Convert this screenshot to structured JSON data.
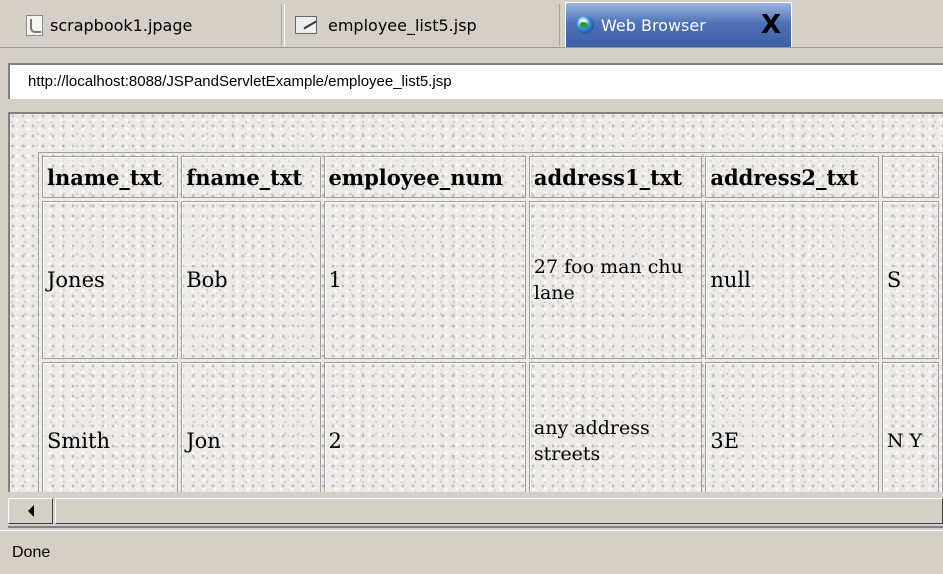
{
  "tabs": [
    {
      "label": "scrapbook1.jpage",
      "icon": "jpage-file-icon",
      "active": false
    },
    {
      "label": "employee_list5.jsp",
      "icon": "jsp-file-icon",
      "active": false
    },
    {
      "label": "Web Browser",
      "icon": "globe-icon",
      "active": true,
      "close_label": "X"
    }
  ],
  "address": {
    "url": "http://localhost:8088/JSPandServletExample/employee_list5.jsp"
  },
  "table": {
    "columns": [
      "lname_txt",
      "fname_txt",
      "employee_num",
      "address1_txt",
      "address2_txt"
    ],
    "rows": [
      {
        "cells": [
          "Jones",
          "Bob",
          "1",
          "27 foo man chu lane",
          "null",
          "S"
        ]
      },
      {
        "cells": [
          "Smith",
          "Jon",
          "2",
          "any address streets",
          "3E",
          "N Y"
        ]
      }
    ]
  },
  "status": {
    "text": "Done"
  },
  "colors": {
    "active_tab": "#4f72b8",
    "chrome": "#d4d0c8"
  }
}
